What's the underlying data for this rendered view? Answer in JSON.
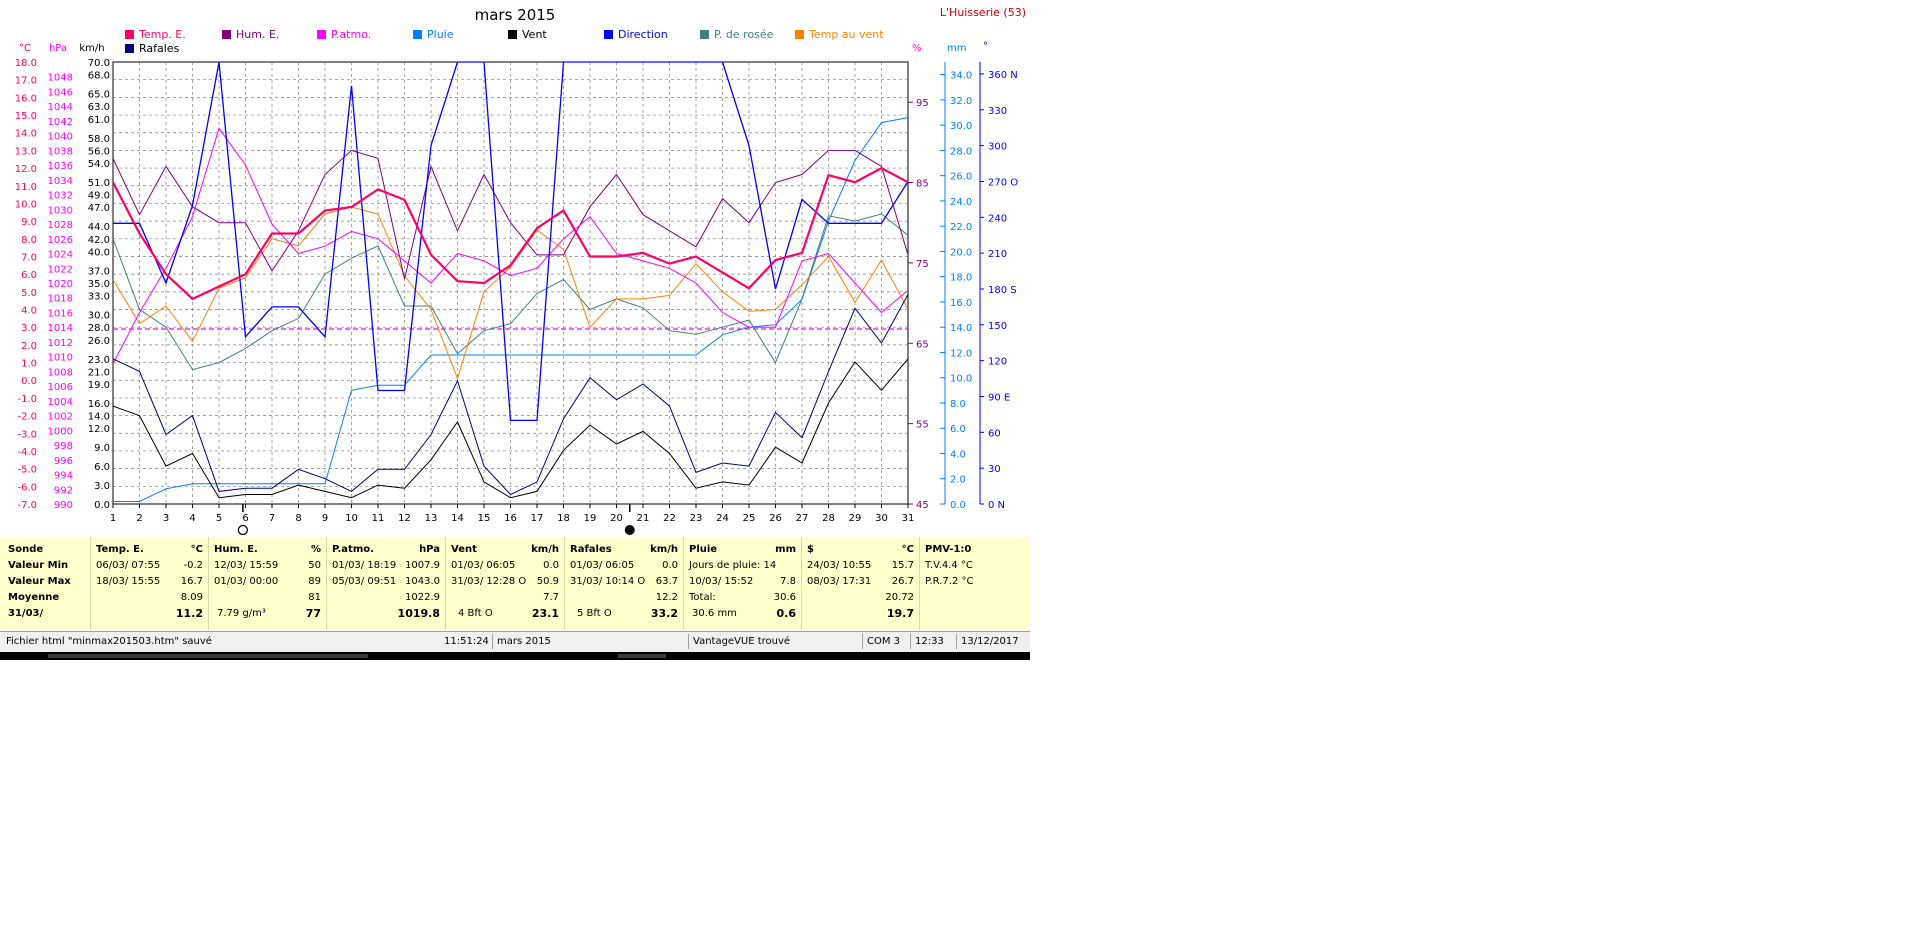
{
  "title": "mars 2015",
  "station": "L'Huisserie (53)",
  "colors": {
    "temp": "#ff0066",
    "hum": "#800080",
    "patmo": "#ff00ff",
    "pluie": "#0080ff",
    "vent": "#000000",
    "direction": "#0000ff",
    "rosee": "#408080",
    "tvent": "#ff8000",
    "rafales": "#000080",
    "grid": "#808080"
  },
  "legend": [
    {
      "label": "Temp. E.",
      "color": "#ff0066"
    },
    {
      "label": "Hum. E.",
      "color": "#800080"
    },
    {
      "label": "P.atmo.",
      "color": "#ff00ff"
    },
    {
      "label": "Pluie",
      "color": "#0080ff"
    },
    {
      "label": "Vent",
      "color": "#000000"
    },
    {
      "label": "Direction",
      "color": "#0000ff"
    },
    {
      "label": "P. de rosée",
      "color": "#408080"
    },
    {
      "label": "Temp au vent",
      "color": "#ff8000"
    },
    {
      "label": "Rafales",
      "color": "#000080"
    }
  ],
  "axis_units": {
    "temp": "°C",
    "patmo": "hPa",
    "wind": "km/h",
    "hum": "%",
    "rain": "mm",
    "dir": "°"
  },
  "chart_data": {
    "type": "line",
    "title": "mars 2015",
    "x": [
      1,
      2,
      3,
      4,
      5,
      6,
      7,
      8,
      9,
      10,
      11,
      12,
      13,
      14,
      15,
      16,
      17,
      18,
      19,
      20,
      21,
      22,
      23,
      24,
      25,
      26,
      27,
      28,
      29,
      30,
      31
    ],
    "axes": {
      "temp": {
        "min": -7.0,
        "max": 18.0,
        "ticks": [
          "18.0",
          "17.0",
          "16.0",
          "15.0",
          "14.0",
          "13.0",
          "12.0",
          "11.0",
          "10.0",
          "9.0",
          "8.0",
          "7.0",
          "6.0",
          "5.0",
          "4.0",
          "3.0",
          "2.0",
          "1.0",
          "0.0",
          "-1.0",
          "-2.0",
          "-3.0",
          "-4.0",
          "-5.0",
          "-6.0",
          "-7.0"
        ]
      },
      "patmo": {
        "min": 990,
        "max": 1050,
        "ticks": [
          "1048",
          "1046",
          "1044",
          "1042",
          "1040",
          "1038",
          "1036",
          "1034",
          "1032",
          "1030",
          "1028",
          "1026",
          "1024",
          "1022",
          "1020",
          "1018",
          "1016",
          "1014",
          "1012",
          "1010",
          "1008",
          "1006",
          "1004",
          "1002",
          "1000",
          "998",
          "996",
          "994",
          "992",
          "990"
        ]
      },
      "wind": {
        "min": 0,
        "max": 70,
        "ticks": [
          "70.0",
          "68.0",
          "65.0",
          "63.0",
          "61.0",
          "58.0",
          "56.0",
          "54.0",
          "51.0",
          "49.0",
          "47.0",
          "44.0",
          "42.0",
          "40.0",
          "37.0",
          "35.0",
          "33.0",
          "30.0",
          "28.0",
          "26.0",
          "23.0",
          "21.0",
          "19.0",
          "16.0",
          "14.0",
          "12.0",
          "9.0",
          "6.0",
          "3.0",
          "0.0"
        ]
      },
      "hum": {
        "min": 45,
        "max": 100,
        "ticks": [
          "95",
          "85",
          "75",
          "65",
          "55",
          "45"
        ]
      },
      "rain": {
        "min": 0,
        "max": 35,
        "ticks": [
          "34.0",
          "32.0",
          "30.0",
          "28.0",
          "26.0",
          "24.0",
          "22.0",
          "20.0",
          "18.0",
          "16.0",
          "14.0",
          "12.0",
          "10.0",
          "8.0",
          "6.0",
          "4.0",
          "2.0",
          "0.0"
        ]
      },
      "dir": {
        "min": 0,
        "max": 370,
        "ticks": [
          "360 N",
          "330",
          "300",
          "270 O",
          "240",
          "210",
          "180 S",
          "150",
          "120",
          "90  E",
          "60",
          "30",
          "0    N"
        ]
      }
    },
    "series": [
      {
        "name": "Temp. E.",
        "key": "temp",
        "axis": "temp",
        "width": 2.2,
        "values": [
          11.2,
          8.3,
          6.0,
          4.6,
          5.3,
          6.0,
          8.3,
          8.3,
          9.6,
          9.8,
          10.8,
          10.2,
          7.1,
          5.6,
          5.5,
          6.5,
          8.6,
          9.6,
          7.0,
          7.0,
          7.2,
          6.6,
          7.0,
          6.1,
          5.2,
          6.8,
          7.2,
          11.6,
          11.2,
          12.0,
          11.2
        ]
      },
      {
        "name": "Hum. E.",
        "key": "hum",
        "axis": "hum",
        "width": 1,
        "values": [
          88,
          81,
          87,
          82,
          80,
          80,
          74,
          79,
          86,
          89,
          88,
          73,
          87,
          79,
          86,
          80,
          76,
          76,
          82,
          86,
          81,
          79,
          77,
          83,
          80,
          85,
          86,
          89,
          89,
          87,
          76
        ]
      },
      {
        "name": "P.atmo.",
        "key": "patmo",
        "axis": "patmo",
        "width": 1,
        "values": [
          1009,
          1016,
          1022,
          1029,
          1041,
          1036,
          1028,
          1024,
          1025,
          1027,
          1026,
          1023,
          1020,
          1024,
          1023,
          1021,
          1022,
          1026,
          1029,
          1024,
          1023,
          1022,
          1020,
          1016,
          1014,
          1014,
          1023,
          1024,
          1020,
          1016,
          1019
        ]
      },
      {
        "name": "Pluie",
        "key": "pluie",
        "axis": "rain",
        "width": 1,
        "values": [
          0.2,
          0.2,
          1.2,
          1.6,
          1.6,
          1.6,
          1.6,
          1.6,
          1.6,
          9.0,
          9.4,
          9.4,
          11.8,
          11.8,
          11.8,
          11.8,
          11.8,
          11.8,
          11.8,
          11.8,
          11.8,
          11.8,
          11.8,
          13.4,
          14.0,
          14.2,
          16.2,
          22.4,
          27.2,
          30.2,
          30.6
        ]
      },
      {
        "name": "Vent",
        "key": "vent",
        "axis": "wind",
        "width": 1,
        "values": [
          15.5,
          14.0,
          6.0,
          8.0,
          1.0,
          1.5,
          1.5,
          3.0,
          2.0,
          1.0,
          3.0,
          2.5,
          7.0,
          13.0,
          3.5,
          1.0,
          2.0,
          8.5,
          12.5,
          9.5,
          11.5,
          8.0,
          2.5,
          3.5,
          3.0,
          9.0,
          6.5,
          16.0,
          22.5,
          18.0,
          23.0
        ]
      },
      {
        "name": "Direction",
        "key": "direction",
        "axis": "dir",
        "width": 1.3,
        "values": [
          235,
          235,
          185,
          250,
          370,
          140,
          165,
          165,
          140,
          350,
          95,
          95,
          300,
          370,
          370,
          70,
          70,
          370,
          370,
          370,
          370,
          370,
          370,
          370,
          300,
          180,
          255,
          235,
          235,
          235,
          270
        ]
      },
      {
        "name": "P. de rosée",
        "key": "rosee",
        "axis": "temp",
        "width": 1,
        "values": [
          8.0,
          4.0,
          3.0,
          0.6,
          1.0,
          1.8,
          2.8,
          3.5,
          6.0,
          6.9,
          7.6,
          4.2,
          4.2,
          1.5,
          2.8,
          3.2,
          4.9,
          5.7,
          4.0,
          4.6,
          4.1,
          2.8,
          2.6,
          3.0,
          3.4,
          1.0,
          4.6,
          9.3,
          9.0,
          9.4,
          8.2
        ]
      },
      {
        "name": "Temp au vent",
        "key": "tvent",
        "axis": "temp",
        "width": 1,
        "values": [
          5.7,
          3.2,
          4.2,
          2.2,
          5.2,
          5.8,
          8.0,
          7.6,
          9.4,
          9.8,
          9.4,
          5.9,
          4.0,
          0.1,
          5.0,
          6.4,
          8.5,
          7.4,
          3.0,
          4.6,
          4.6,
          4.8,
          6.6,
          5.0,
          3.9,
          4.0,
          5.4,
          7.0,
          4.4,
          6.8,
          4.0
        ]
      },
      {
        "name": "Rafales",
        "key": "rafales",
        "axis": "wind",
        "width": 1,
        "values": [
          23.0,
          21.0,
          11.0,
          14.0,
          2.0,
          2.5,
          2.5,
          5.5,
          4.0,
          2.0,
          5.5,
          5.5,
          11.0,
          19.5,
          6.0,
          1.5,
          3.5,
          13.5,
          20.0,
          16.5,
          19.0,
          15.5,
          5.0,
          6.5,
          6.0,
          14.5,
          10.5,
          21.0,
          31.0,
          25.5,
          33.2
        ]
      }
    ],
    "reference_line": {
      "axis": "temp",
      "value": 2.9
    },
    "moon_phases": [
      {
        "day": 5.9,
        "type": "full"
      },
      {
        "day": 20.5,
        "type": "new"
      }
    ]
  },
  "stats": {
    "row_labels": [
      "Sonde",
      "Valeur Min",
      "Valeur Max",
      "Moyenne",
      "31/03/"
    ],
    "temp": {
      "header": "Temp. E.",
      "unit": "°C",
      "min_time": "06/03/  07:55",
      "min": "-0.2",
      "max_time": "18/03/  15:55",
      "max": "16.7",
      "avg": "8.09",
      "last": "11.2"
    },
    "hum": {
      "header": "Hum. E.",
      "unit": "%",
      "min_time": "12/03/  15:59",
      "min": "50",
      "max_time": "01/03/  00:00",
      "max": "89",
      "avg": "81",
      "last_extra": "7.79 g/m³",
      "last": "77"
    },
    "patmo": {
      "header": "P.atmo.",
      "unit": "hPa",
      "min_time": "01/03/  18:19",
      "min": "1007.9",
      "max_time": "05/03/  09:51",
      "max": "1043.0",
      "avg": "1022.9",
      "last": "1019.8"
    },
    "vent": {
      "header": "Vent",
      "unit": "km/h",
      "min_time": "01/03/  06:05",
      "min": "0.0",
      "max_time": "31/03/  12:28  O",
      "max": "50.9",
      "avg": "7.7",
      "last_extra": "4 Bft O",
      "last": "23.1"
    },
    "rafales": {
      "header": "Rafales",
      "unit": "km/h",
      "min_time": "01/03/  06:05",
      "min": "0.0",
      "max_time": "31/03/  10:14  O",
      "max": "63.7",
      "avg": "12.2",
      "last_extra": "5 Bft O",
      "last": "33.2"
    },
    "pluie": {
      "header": "Pluie",
      "unit": "mm",
      "min_label": "Jours de pluie: 14",
      "max_time": "10/03/  15:52",
      "max": "7.8",
      "total_label": "Total:",
      "total": "30.6",
      "last_extra": "30.6 mm",
      "last": "0.6"
    },
    "s": {
      "header": "$",
      "unit": "°C",
      "min_time": "24/03/  10:55",
      "min": "15.7",
      "max_time": "08/03/  17:31",
      "max": "26.7",
      "avg": "20.72",
      "last": "19.7"
    },
    "pmv": {
      "header": "PMV-1:0",
      "tv": "T.V.4.4 °C",
      "pr": "P.R.7.2 °C"
    }
  },
  "statusbar": {
    "file": "Fichier html  \"minmax201503.htm\"  sauvé",
    "time": "11:51:24",
    "month": "mars 2015",
    "device": "VantageVUE trouvé",
    "port": "COM 3",
    "clock": "12:33",
    "date": "13/12/2017"
  }
}
